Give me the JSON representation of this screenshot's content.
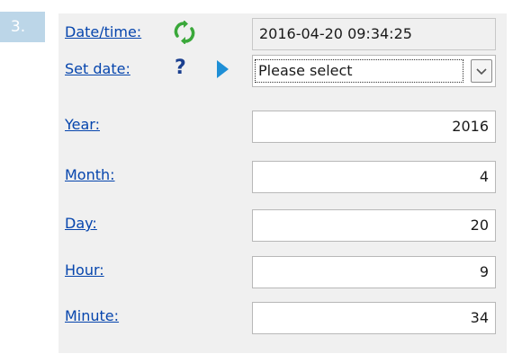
{
  "step": {
    "number": "3."
  },
  "rows": {
    "datetime": {
      "label": "Date/time:",
      "value": "2016-04-20 09:34:25",
      "icon": "refresh-icon"
    },
    "set_date": {
      "label": "Set date:",
      "selected": "Please select",
      "help_icon": "help-icon",
      "indicator_icon": "arrow-right-icon"
    },
    "year": {
      "label": "Year:",
      "value": "2016"
    },
    "month": {
      "label": "Month:",
      "value": "4"
    },
    "day": {
      "label": "Day:",
      "value": "20"
    },
    "hour": {
      "label": "Hour:",
      "value": "9"
    },
    "minute": {
      "label": "Minute:",
      "value": "34"
    }
  },
  "colors": {
    "step_badge": "#bcd6e8",
    "panel_background": "#f0f0f0",
    "link": "#0645ad",
    "refresh_icon": "#3aa83a",
    "help_icon": "#1a3f8f",
    "arrow_icon": "#1e8fd6"
  }
}
